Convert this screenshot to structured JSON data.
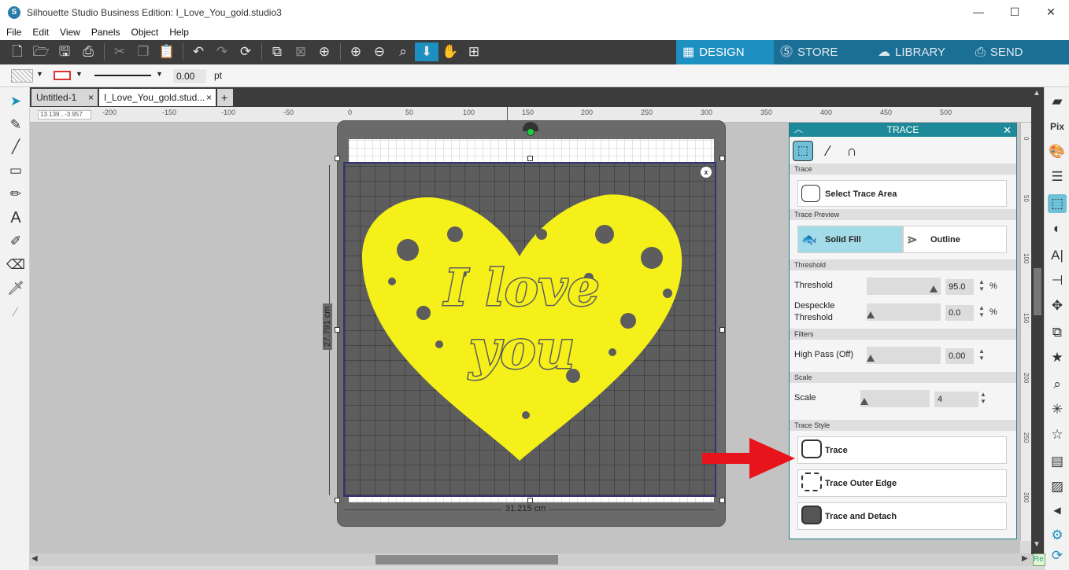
{
  "window": {
    "title": "Silhouette Studio Business Edition: I_Love_You_gold.studio3",
    "minimize": "—",
    "maximize": "☐",
    "close": "✕"
  },
  "menu": [
    "File",
    "Edit",
    "View",
    "Panels",
    "Object",
    "Help"
  ],
  "main_tabs": {
    "design": "DESIGN",
    "store": "STORE",
    "library": "LIBRARY",
    "send": "SEND"
  },
  "stylebar": {
    "line_width": "0.00",
    "unit": "pt"
  },
  "doc_tabs": [
    {
      "label": "Untitled-1",
      "close": "×"
    },
    {
      "label": "I_Love_You_gold.stud...",
      "close": "×"
    }
  ],
  "add_tab": "+",
  "cursor_coords": "13.139 , -3.957",
  "ruler_h": [
    "-200",
    "-150",
    "-100",
    "-50",
    "0",
    "50",
    "100",
    "150",
    "200",
    "250",
    "300",
    "350",
    "400",
    "450",
    "500"
  ],
  "ruler_v": [
    "0",
    "50",
    "100",
    "150",
    "200",
    "250",
    "300"
  ],
  "dimensions": {
    "height": "27.791 cm",
    "width": "31.215 cm"
  },
  "artwork": {
    "line1": "I love",
    "line2": "you",
    "color": "#f5f01a"
  },
  "trace_panel": {
    "title": "TRACE",
    "sections": {
      "trace": "Trace",
      "preview": "Trace Preview",
      "threshold": "Threshold",
      "filters": "Filters",
      "scale": "Scale",
      "style": "Trace Style"
    },
    "select_trace_area": "Select Trace Area",
    "solid_fill": "Solid Fill",
    "outline": "Outline",
    "threshold_label": "Threshold",
    "threshold_value": "95.0",
    "threshold_unit": "%",
    "despeckle_label_1": "Despeckle",
    "despeckle_label_2": "Threshold",
    "despeckle_value": "0.0",
    "despeckle_unit": "%",
    "high_pass_label": "High Pass (Off)",
    "high_pass_value": "0.00",
    "scale_label": "Scale",
    "scale_value": "4",
    "style_trace": "Trace",
    "style_outer": "Trace Outer Edge",
    "style_detach": "Trace and Detach"
  },
  "colors": {
    "toolbar": "#3c3c3c",
    "accent": "#1e8fc1",
    "panel_header": "#1e8a99",
    "arrow": "#e8141b"
  },
  "status_corner": "Re"
}
